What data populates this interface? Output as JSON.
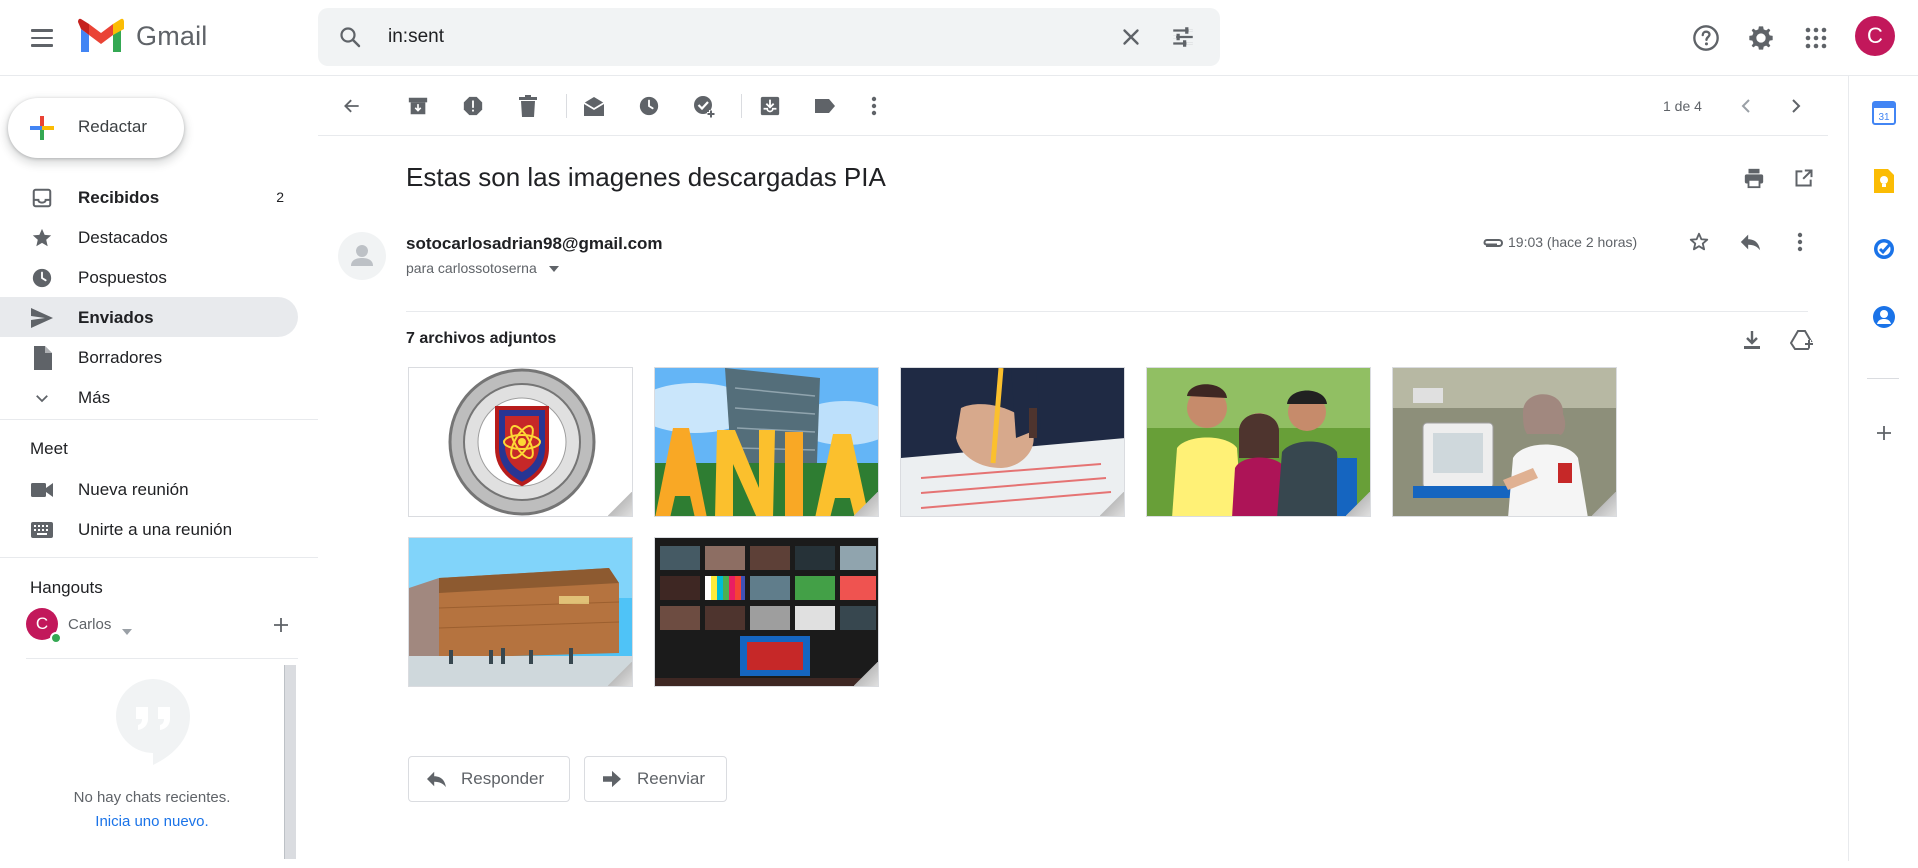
{
  "app": {
    "name": "Gmail"
  },
  "search": {
    "query": "in:sent"
  },
  "user": {
    "initial": "C"
  },
  "compose": {
    "label": "Redactar"
  },
  "nav": [
    {
      "label": "Recibidos",
      "count": "2",
      "icon": "inbox-icon",
      "bold": true
    },
    {
      "label": "Destacados",
      "count": "",
      "icon": "star-icon"
    },
    {
      "label": "Pospuestos",
      "count": "",
      "icon": "clock-icon"
    },
    {
      "label": "Enviados",
      "count": "",
      "icon": "send-icon",
      "active": true
    },
    {
      "label": "Borradores",
      "count": "",
      "icon": "draft-icon"
    },
    {
      "label": "Más",
      "count": "",
      "icon": "chevron-down-icon"
    }
  ],
  "meet": {
    "title": "Meet",
    "items": [
      {
        "label": "Nueva reunión",
        "icon": "videocam-icon"
      },
      {
        "label": "Unirte a una reunión",
        "icon": "keyboard-icon"
      }
    ]
  },
  "hangouts": {
    "title": "Hangouts",
    "user_name": "Carlos",
    "user_initial": "C",
    "empty_text": "No hay chats recientes.",
    "new_link": "Inicia uno nuevo."
  },
  "pager": {
    "text": "1 de 4"
  },
  "message": {
    "subject": "Estas son las imagenes descargadas PIA",
    "sender": "sotocarlosadrian98@gmail.com",
    "recipient": "para carlossotoserna",
    "time": "19:03 (hace 2 horas)",
    "attachments_title": "7 archivos adjuntos"
  },
  "attachments": [
    {
      "subject": "university-seal"
    },
    {
      "subject": "building-letters"
    },
    {
      "subject": "hand-writing"
    },
    {
      "subject": "students"
    },
    {
      "subject": "lab-worker"
    },
    {
      "subject": "brick-building"
    },
    {
      "subject": "tv-studio"
    }
  ],
  "actions": {
    "reply": "Responder",
    "forward": "Reenviar"
  },
  "rail": {
    "calendar_day": "31"
  },
  "colors": {
    "accent": "#1a73e8",
    "avatar": "#c2185b",
    "active_nav": "#e8eaed"
  }
}
